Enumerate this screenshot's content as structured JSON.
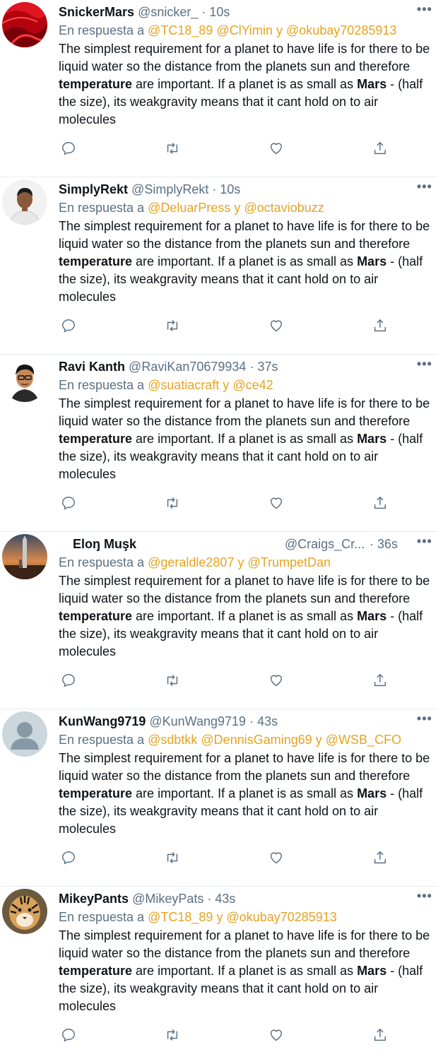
{
  "reply_prefix": "En respuesta a",
  "body_parts": {
    "t1": "The simplest requirement for a planet to have life is for there to be liquid water so the distance from the planets sun and therefore ",
    "b1": "temperature",
    "t2": " are important. If a planet is as small as ",
    "b2": "Mars",
    "t3": " - (half the size), its weakgravity means that it cant hold on to air molecules"
  },
  "more_label": "•••",
  "mention_color": "#e7a321",
  "tweets": [
    {
      "name": "SnickerMars",
      "handle": "@snicker_",
      "time": "· 10s",
      "mentions": [
        "@TC18_89",
        "@ClYimin"
      ],
      "joiner": "y",
      "last_mention": "@okubay70285913",
      "avatar": "red-silk-avatar"
    },
    {
      "name": "SimplyRekt",
      "handle": "@SimplyRekt",
      "time": "· 10s",
      "mentions": [
        "@DeluarPress"
      ],
      "joiner": "y",
      "last_mention": "@octaviobuzz",
      "avatar": "man-portrait-avatar"
    },
    {
      "name": "Ravi Kanth",
      "handle": "@RaviKan70679934",
      "time": "· 37s",
      "mentions": [
        "@suatiacraft"
      ],
      "joiner": "y",
      "last_mention": "@ce42",
      "avatar": "cartoon-boy-avatar"
    },
    {
      "name": "Eloŋ Muşk",
      "handle": "@Craigs_Cr...",
      "time": "· 36s",
      "mentions": [
        "@geraldle2807"
      ],
      "joiner": "y",
      "last_mention": "@TrumpetDan",
      "avatar": "rocket-sunset-avatar"
    },
    {
      "name": "KunWang9719",
      "handle": "@KunWang9719",
      "time": "· 43s",
      "mentions": [
        "@sdbtkk",
        "@DennisGaming69"
      ],
      "joiner": "y",
      "last_mention": "@WSB_CFO",
      "avatar": "default-profile-avatar"
    },
    {
      "name": "MikeyPants",
      "handle": "@MikeyPats",
      "time": "· 43s",
      "mentions": [
        "@TC18_89"
      ],
      "joiner": "y",
      "last_mention": "@okubay70285913",
      "avatar": "tiger-avatar"
    }
  ],
  "icons": [
    "reply-icon",
    "retweet-icon",
    "like-icon",
    "share-icon",
    "more-icon"
  ]
}
